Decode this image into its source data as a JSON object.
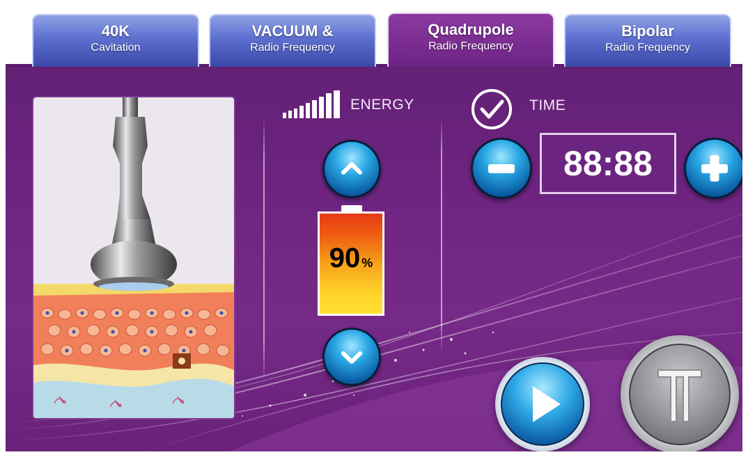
{
  "tabs": [
    {
      "line1": "40K",
      "line2": "Cavitation",
      "active": false
    },
    {
      "line1": "VACUUM &",
      "line2": "Radio Frequency",
      "active": false
    },
    {
      "line1": "Quadrupole",
      "line2": "Radio Frequency",
      "active": true
    },
    {
      "line1": "Bipolar",
      "line2": "Radio Frequency",
      "active": false
    }
  ],
  "energy": {
    "label": "ENERGY",
    "value": "90",
    "unit": "%",
    "level_fraction": 0.9,
    "up_icon": "chevron-up-icon",
    "down_icon": "chevron-down-icon"
  },
  "time": {
    "label": "TIME",
    "value": "88:88",
    "check_icon": "check-circle-icon",
    "minus_icon": "minus-icon",
    "plus_icon": "plus-icon"
  },
  "controls": {
    "play_icon": "play-icon",
    "pause_icon": "pause-icon"
  },
  "colors": {
    "background": "#6d2480",
    "tab_inactive": "#5d6fcf",
    "tab_active": "#7a2b8f",
    "button_blue": "#29a7e4",
    "battery_top": "#e53a16",
    "battery_bottom": "#ffe033"
  }
}
